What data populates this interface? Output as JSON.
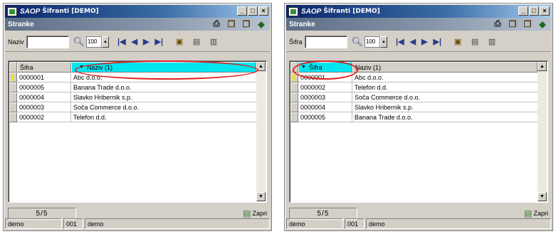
{
  "colors": {
    "sort_highlight": "#00e6f0",
    "annotation": "#e02020",
    "title_bar": "#0a246a"
  },
  "windows": [
    {
      "title_app": "SAOP",
      "title_rest": "Šifranti [DEMO]",
      "title_buttons": [
        "_",
        "□",
        "×"
      ],
      "header": "Stranke",
      "header_icons": [
        "printer-icon",
        "copy-icon",
        "copy-icon",
        "exit-icon"
      ],
      "search_label": "Naziv",
      "search_value": "",
      "row_count": "100",
      "columns": {
        "code": "Šifra",
        "name": "Naziv (1)"
      },
      "sorted_column": "name",
      "rows": [
        {
          "code": "0000001",
          "name": "Abc d.o.o."
        },
        {
          "code": "0000005",
          "name": "Banana Trade d.o.o."
        },
        {
          "code": "0000004",
          "name": "Slavko Hribernik s.p."
        },
        {
          "code": "0000003",
          "name": "Soča Commerce d.o.o."
        },
        {
          "code": "0000002",
          "name": "Telefon d.d."
        }
      ],
      "pager": "5/5",
      "close_label": "Zapri",
      "status": {
        "user": "demo",
        "code": "001",
        "company": "demo"
      }
    },
    {
      "title_app": "SAOP",
      "title_rest": "Šifranti [DEMO]",
      "title_buttons": [
        "_",
        "□",
        "×"
      ],
      "header": "Stranke",
      "header_icons": [
        "printer-icon",
        "copy-icon",
        "copy-icon",
        "exit-icon"
      ],
      "search_label": "Šifra",
      "search_value": "",
      "row_count": "100",
      "columns": {
        "code": "Šifra",
        "name": "Naziv (1)"
      },
      "sorted_column": "code",
      "rows": [
        {
          "code": "0000001",
          "name": "Abc d.o.o."
        },
        {
          "code": "0000002",
          "name": "Telefon d.d."
        },
        {
          "code": "0000003",
          "name": "Soča Commerce d.o.o."
        },
        {
          "code": "0000004",
          "name": "Slavko Hribernik s.p."
        },
        {
          "code": "0000005",
          "name": "Banana Trade d.o.o."
        }
      ],
      "pager": "5/5",
      "close_label": "Zapri",
      "status": {
        "user": "demo",
        "code": "001",
        "company": "demo"
      }
    }
  ]
}
